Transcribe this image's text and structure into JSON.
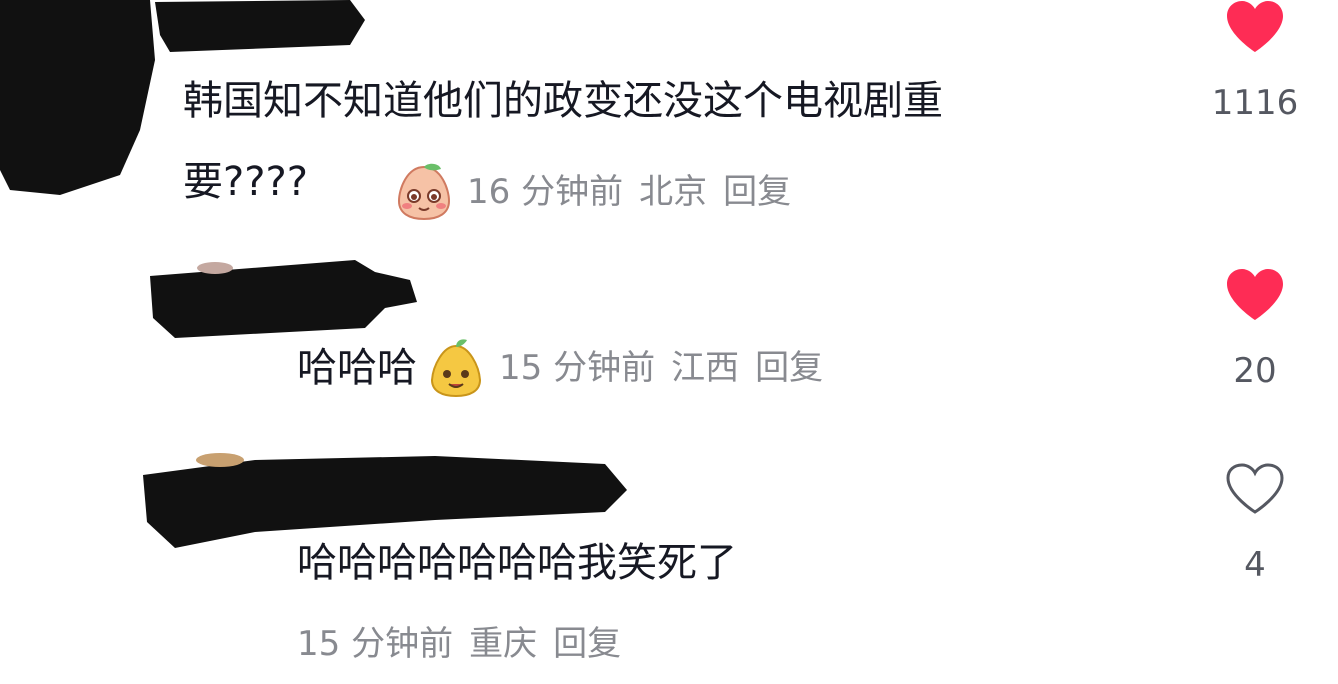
{
  "colors": {
    "text": "#161823",
    "meta": "#888a90",
    "like_active": "#fe2c55",
    "like_inactive": "#555861",
    "redaction": "#111111"
  },
  "comments": [
    {
      "text_line1": "韩国知不知道他们的政变还没这个电视剧重",
      "text_line2": "要????",
      "emoji": "blushing-peach-emoji",
      "time": "16 分钟前",
      "location": "北京",
      "reply": "回复",
      "likes": "1116",
      "liked": true
    },
    {
      "text": "哈哈哈",
      "emoji": "smiling-pear-emoji",
      "time": "15 分钟前",
      "location": "江西",
      "reply": "回复",
      "likes": "20",
      "liked": true
    },
    {
      "text": "哈哈哈哈哈哈哈我笑死了",
      "time": "15 分钟前",
      "location": "重庆",
      "reply": "回复",
      "likes": "4",
      "liked": false
    }
  ]
}
